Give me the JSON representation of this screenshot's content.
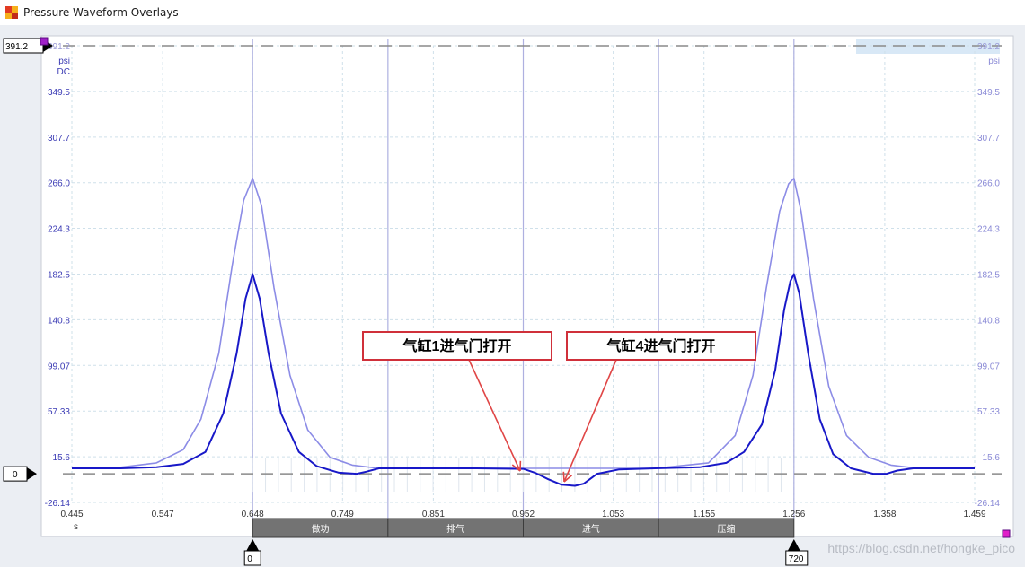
{
  "window": {
    "title": "Pressure Waveform Overlays"
  },
  "icons": {
    "app": "app-icon"
  },
  "colors": {
    "series1": "#1818c8",
    "series2": "#8c8ce6",
    "axis_text": "#3a3ab4",
    "grid": "#cfe0ea",
    "phase_bar": "#737373",
    "annotation_border": "#d0303a",
    "annotation_arrow": "#e04646"
  },
  "chart_data": {
    "type": "line",
    "title": "",
    "xlabel": "s",
    "ylabel": "psi",
    "ylabel_sub": "DC",
    "xlim": [
      0.445,
      1.459
    ],
    "ylim": [
      -26.14,
      391.2
    ],
    "x_ticks": [
      "0.445",
      "0.547",
      "0.648",
      "0.749",
      "0.851",
      "0.952",
      "1.053",
      "1.155",
      "1.256",
      "1.358",
      "1.459"
    ],
    "y_ticks": [
      "391.2",
      "349.5",
      "307.7",
      "266.0",
      "224.3",
      "182.5",
      "140.8",
      "99.07",
      "57.33",
      "15.6",
      "-26.14"
    ],
    "y_ticks_right": [
      "391.2",
      "349.5",
      "307.7",
      "266.0",
      "224.3",
      "182.5",
      "140.8",
      "99.07",
      "57.33",
      "15.6",
      "-26.14"
    ],
    "grid": true,
    "upper_reference": "391.2",
    "lower_reference": "0",
    "series": [
      {
        "x": [
          0.445,
          0.5,
          0.54,
          0.57,
          0.595,
          0.615,
          0.63,
          0.64,
          0.648,
          0.656,
          0.666,
          0.68,
          0.7,
          0.72,
          0.745,
          0.765,
          0.776,
          0.79,
          0.81,
          0.85,
          0.9,
          0.952,
          0.965,
          0.98,
          0.995,
          1.01,
          1.02,
          1.035,
          1.06,
          1.1,
          1.15,
          1.18,
          1.2,
          1.22,
          1.235,
          1.245,
          1.252,
          1.256,
          1.262,
          1.272,
          1.285,
          1.3,
          1.32,
          1.345,
          1.36,
          1.372,
          1.39,
          1.42,
          1.459
        ],
        "y": [
          5,
          5,
          6,
          9,
          20,
          55,
          110,
          160,
          182.5,
          160,
          110,
          55,
          20,
          7,
          1,
          0,
          2,
          5,
          5,
          5,
          5,
          4.5,
          1,
          -5,
          -10,
          -11,
          -9,
          0,
          4,
          5,
          6,
          10,
          20,
          45,
          95,
          150,
          176,
          182.5,
          165,
          110,
          50,
          18,
          5,
          0,
          0,
          3,
          5,
          5,
          5
        ]
      },
      {
        "x": [
          0.445,
          0.5,
          0.54,
          0.57,
          0.59,
          0.61,
          0.625,
          0.638,
          0.648,
          0.658,
          0.672,
          0.69,
          0.71,
          0.735,
          0.76,
          0.79,
          0.8,
          0.9,
          0.952,
          1.0,
          1.1,
          1.16,
          1.19,
          1.21,
          1.225,
          1.24,
          1.25,
          1.256,
          1.264,
          1.278,
          1.295,
          1.315,
          1.34,
          1.365,
          1.385,
          1.42,
          1.459
        ],
        "y": [
          5,
          6,
          10,
          22,
          50,
          110,
          190,
          250,
          270,
          245,
          170,
          90,
          40,
          15,
          8,
          5,
          5,
          5,
          5,
          5,
          5,
          10,
          35,
          90,
          170,
          240,
          265,
          270,
          240,
          160,
          80,
          35,
          15,
          8,
          6,
          5,
          5
        ]
      }
    ],
    "phase_labels": [
      "做功",
      "排气",
      "进气",
      "压缩"
    ],
    "crank_start": "0",
    "crank_end": "720",
    "annotations": [
      "气缸1进气门打开",
      "气缸4进气门打开"
    ],
    "watermark": "https://blog.csdn.net/hongke_pico"
  }
}
